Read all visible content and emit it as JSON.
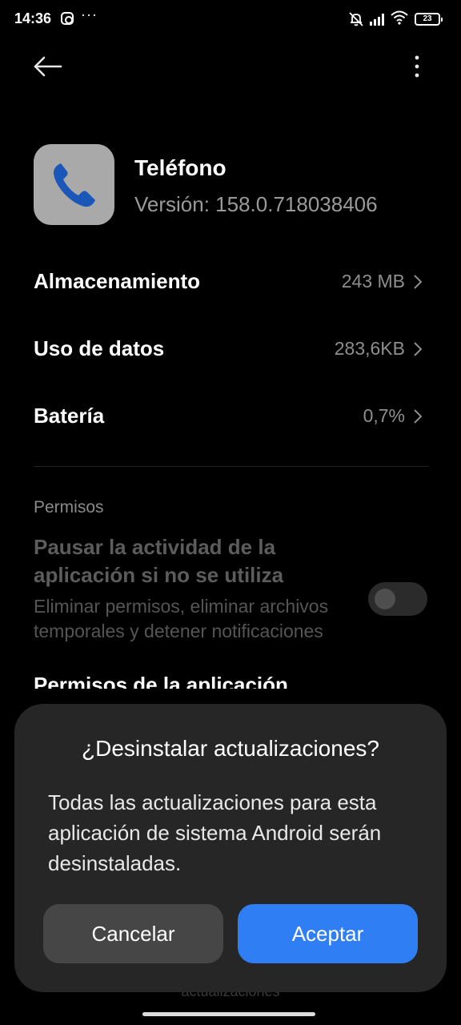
{
  "status_bar": {
    "time": "14:36",
    "more": "···",
    "battery_level": "23"
  },
  "header": {
    "back_icon": "arrow-left-icon",
    "menu_icon": "more-vertical-icon"
  },
  "app": {
    "name": "Teléfono",
    "version": "Versión: 158.0.718038406",
    "icon": "phone-icon",
    "icon_color": "#1a57b8"
  },
  "rows": [
    {
      "label": "Almacenamiento",
      "value": "243 MB"
    },
    {
      "label": "Uso de datos",
      "value": "283,6KB"
    },
    {
      "label": "Batería",
      "value": "0,7%"
    }
  ],
  "permissions": {
    "section_title": "Permisos",
    "pause_title": "Pausar la actividad de la aplicación si no se utiliza",
    "pause_desc": "Eliminar permisos, eliminar archivos temporales y detener notificaciones",
    "pause_enabled": false,
    "app_permissions": "Permisos de la aplicación"
  },
  "under_text": "actualizaciones",
  "dialog": {
    "title": "¿Desinstalar actualizaciones?",
    "message": "Todas las actualizaciones para esta aplicación de sistema Android serán desinstaladas.",
    "cancel_label": "Cancelar",
    "accept_label": "Aceptar",
    "accept_color": "#2f7ef4"
  }
}
